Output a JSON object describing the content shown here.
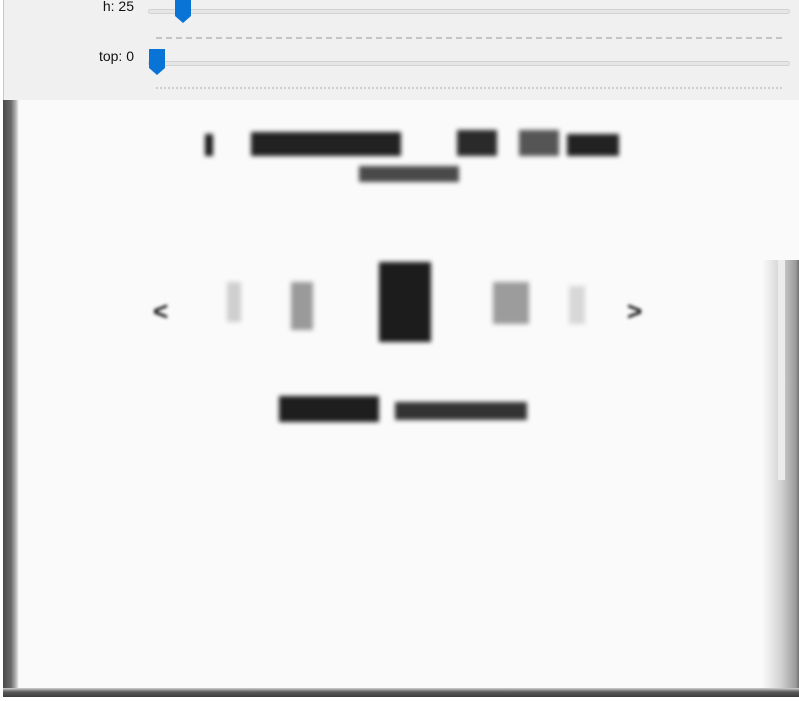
{
  "controls": {
    "sliders": [
      {
        "label": "h: 25",
        "value": 25
      },
      {
        "label": "top: 0",
        "value": 0
      }
    ],
    "accent_color": "#0a74d6"
  },
  "viewer": {
    "left_arrow": "<",
    "right_arrow": ">"
  }
}
